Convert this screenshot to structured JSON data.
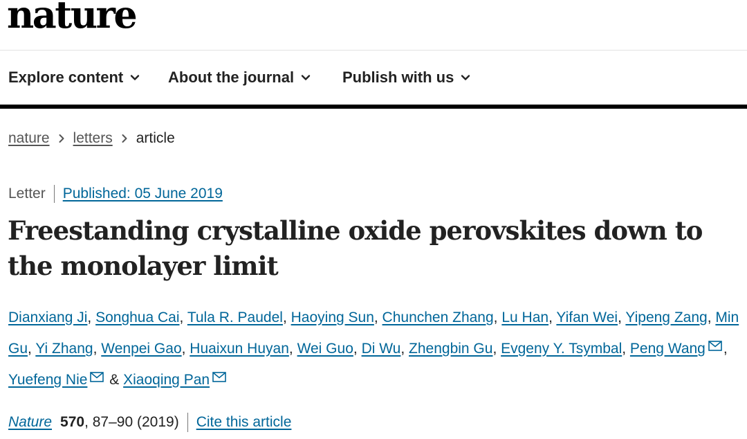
{
  "header": {
    "logo_text": "nature"
  },
  "nav": {
    "items": [
      {
        "label": "Explore content"
      },
      {
        "label": "About the journal"
      },
      {
        "label": "Publish with us"
      }
    ]
  },
  "breadcrumb": {
    "items": [
      "nature",
      "letters"
    ],
    "current": "article"
  },
  "article": {
    "type": "Letter",
    "published": "Published: 05 June 2019",
    "title": "Freestanding crystalline oxide perovskites down to the monolayer limit",
    "authors": [
      "Dianxiang Ji",
      "Songhua Cai",
      "Tula R. Paudel",
      "Haoying Sun",
      "Chunchen Zhang",
      "Lu Han",
      "Yifan Wei",
      "Yipeng Zang",
      "Min Gu",
      "Yi Zhang",
      "Wenpei Gao",
      "Huaixun Huyan",
      "Wei Guo",
      "Di Wu",
      "Zhengbin Gu",
      "Evgeny Y. Tsymbal",
      "Peng Wang",
      "Yuefeng Nie",
      "Xiaoqing Pan"
    ],
    "separators": {
      "comma": ", ",
      "ampersand": " & "
    },
    "corresponding_icon": "mail-icon",
    "citation": {
      "journal": "Nature",
      "volume": "570",
      "pages_year": ", 87–90 (2019)",
      "cite_label": "Cite this article"
    }
  },
  "colors": {
    "link": "#006699",
    "text": "#222222",
    "nav_rule": "#000000"
  }
}
